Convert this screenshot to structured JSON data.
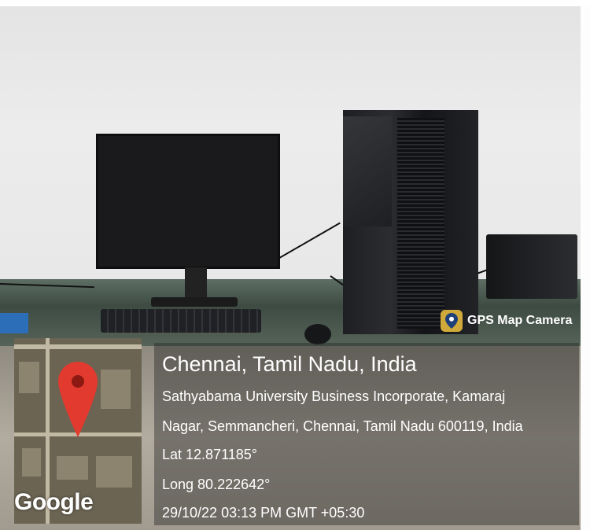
{
  "overlay": {
    "badge_label": "GPS Map Camera",
    "badge_icon": "map-pin-icon",
    "location_title": "Chennai, Tamil Nadu, India",
    "address_line1": "Sathyabama University Business Incorporate, Kamaraj",
    "address_line2": "Nagar, Semmancheri, Chennai, Tamil Nadu 600119, India",
    "latitude": "Lat 12.871185°",
    "longitude": "Long 80.222642°",
    "datetime": "29/10/22 03:13 PM GMT +05:30"
  },
  "map": {
    "brand": "Google",
    "pin_icon": "map-pin-icon",
    "pin_color": "#e23a2e"
  },
  "scene": {
    "objects": [
      "monitor",
      "cpu-tower",
      "ups",
      "keyboard",
      "mouse"
    ]
  }
}
